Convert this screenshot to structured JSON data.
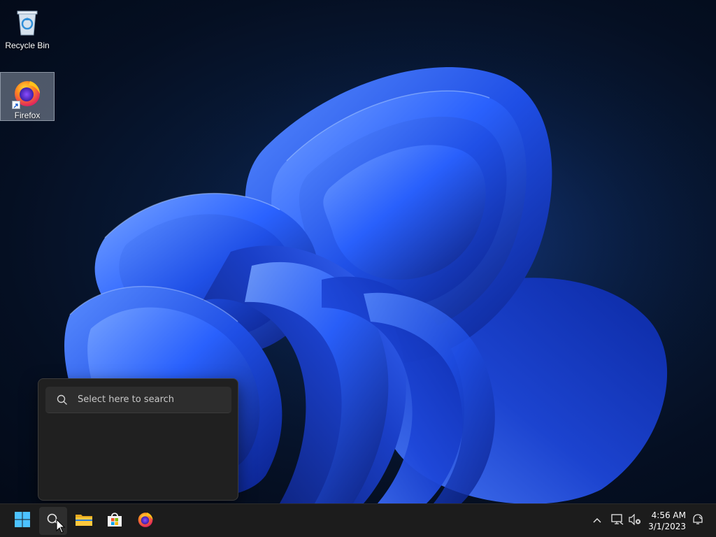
{
  "desktop": {
    "icons": [
      {
        "label": "Recycle Bin",
        "icon": "recycle-bin-icon"
      },
      {
        "label": "Firefox",
        "icon": "firefox-icon"
      }
    ]
  },
  "search_flyout": {
    "placeholder": "Select here to search",
    "icon": "search-icon"
  },
  "taskbar": {
    "pinned": [
      {
        "name": "start",
        "icon": "windows-logo-icon"
      },
      {
        "name": "search",
        "icon": "search-icon"
      },
      {
        "name": "file-explorer",
        "icon": "folder-icon"
      },
      {
        "name": "microsoft-store",
        "icon": "store-icon"
      },
      {
        "name": "firefox",
        "icon": "firefox-icon"
      }
    ],
    "tray": {
      "icons": [
        "chevron-up-icon",
        "network-icon",
        "speaker-muted-icon",
        "notification-icon"
      ],
      "time": "4:56 AM",
      "date": "3/1/2023"
    }
  },
  "colors": {
    "accent": "#2f5cff",
    "taskbar": "#1c1c1c",
    "flyout": "#202020"
  }
}
